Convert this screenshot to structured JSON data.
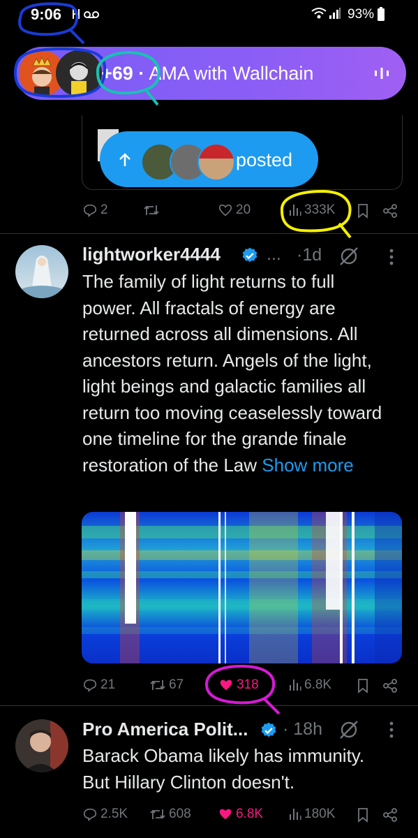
{
  "status_bar": {
    "time": "9:06",
    "battery": "93%"
  },
  "spaces_bar": {
    "listener_count": "+69 ·",
    "title": "AMA with Wallchain"
  },
  "posted_pill": {
    "label": "posted"
  },
  "tweets": [
    {
      "stats": {
        "replies": "2",
        "retweets": "",
        "likes": "20",
        "views": "333K"
      }
    },
    {
      "display_name": "lightworker4444",
      "handle": "...",
      "time": "·1d",
      "text": "The family of light returns to full power. All fractals of energy are returned across all dimensions. All ancestors return. Angels of the light, light beings and galactic families all return too moving ceaselessly toward one timeline for the grande finale restoration of the Law ",
      "show_more": "Show more",
      "stats": {
        "replies": "21",
        "retweets": "67",
        "likes": "318",
        "views": "6.8K"
      }
    },
    {
      "display_name": "Pro America Polit...",
      "time": "· 18h",
      "text": "Barack Obama likely has immunity. But Hillary Clinton doesn't.",
      "stats": {
        "replies": "2.5K",
        "retweets": "608",
        "likes": "6.8K",
        "views": "180K"
      }
    }
  ],
  "colors": {
    "accent": "#1d9bf0",
    "like": "#f91880",
    "spaces": "#8a5ef6",
    "annotation_blue": "#1a3bd6",
    "annotation_teal": "#17c3b2",
    "annotation_yellow": "#f5f000",
    "annotation_magenta": "#d61ad6"
  }
}
